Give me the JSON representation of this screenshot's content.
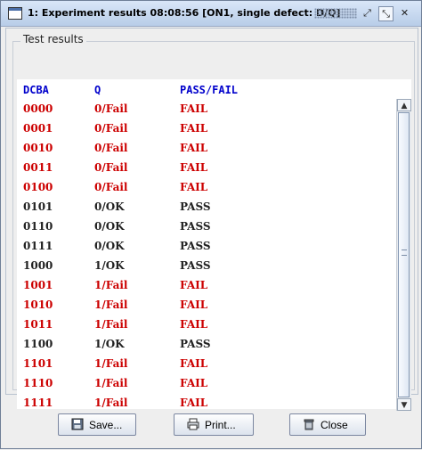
{
  "window": {
    "title": "1: Experiment results 08:08:56 [ON1, single defect: D/Q]",
    "controls": [
      "restore",
      "maximize",
      "close"
    ]
  },
  "group": {
    "label": "Test results"
  },
  "table": {
    "columns": [
      "DCBA",
      "Q",
      "PASS/FAIL"
    ],
    "rows": [
      {
        "dcba": "0000",
        "q": "0/Fail",
        "result": "FAIL",
        "status": "fail"
      },
      {
        "dcba": "0001",
        "q": "0/Fail",
        "result": "FAIL",
        "status": "fail"
      },
      {
        "dcba": "0010",
        "q": "0/Fail",
        "result": "FAIL",
        "status": "fail"
      },
      {
        "dcba": "0011",
        "q": "0/Fail",
        "result": "FAIL",
        "status": "fail"
      },
      {
        "dcba": "0100",
        "q": "0/Fail",
        "result": "FAIL",
        "status": "fail"
      },
      {
        "dcba": "0101",
        "q": "0/OK",
        "result": "PASS",
        "status": "pass"
      },
      {
        "dcba": "0110",
        "q": "0/OK",
        "result": "PASS",
        "status": "pass"
      },
      {
        "dcba": "0111",
        "q": "0/OK",
        "result": "PASS",
        "status": "pass"
      },
      {
        "dcba": "1000",
        "q": "1/OK",
        "result": "PASS",
        "status": "pass"
      },
      {
        "dcba": "1001",
        "q": "1/Fail",
        "result": "FAIL",
        "status": "fail"
      },
      {
        "dcba": "1010",
        "q": "1/Fail",
        "result": "FAIL",
        "status": "fail"
      },
      {
        "dcba": "1011",
        "q": "1/Fail",
        "result": "FAIL",
        "status": "fail"
      },
      {
        "dcba": "1100",
        "q": "1/OK",
        "result": "PASS",
        "status": "pass"
      },
      {
        "dcba": "1101",
        "q": "1/Fail",
        "result": "FAIL",
        "status": "fail"
      },
      {
        "dcba": "1110",
        "q": "1/Fail",
        "result": "FAIL",
        "status": "fail"
      },
      {
        "dcba": "1111",
        "q": "1/Fail",
        "result": "FAIL",
        "status": "fail"
      }
    ]
  },
  "buttons": {
    "save": {
      "label": "Save...",
      "icon": "save-icon"
    },
    "print": {
      "label": "Print...",
      "icon": "print-icon"
    },
    "close": {
      "label": "Close",
      "icon": "trash-icon"
    }
  },
  "colors": {
    "header_text": "#0000cc",
    "fail_text": "#cc0000",
    "pass_text": "#222222"
  }
}
